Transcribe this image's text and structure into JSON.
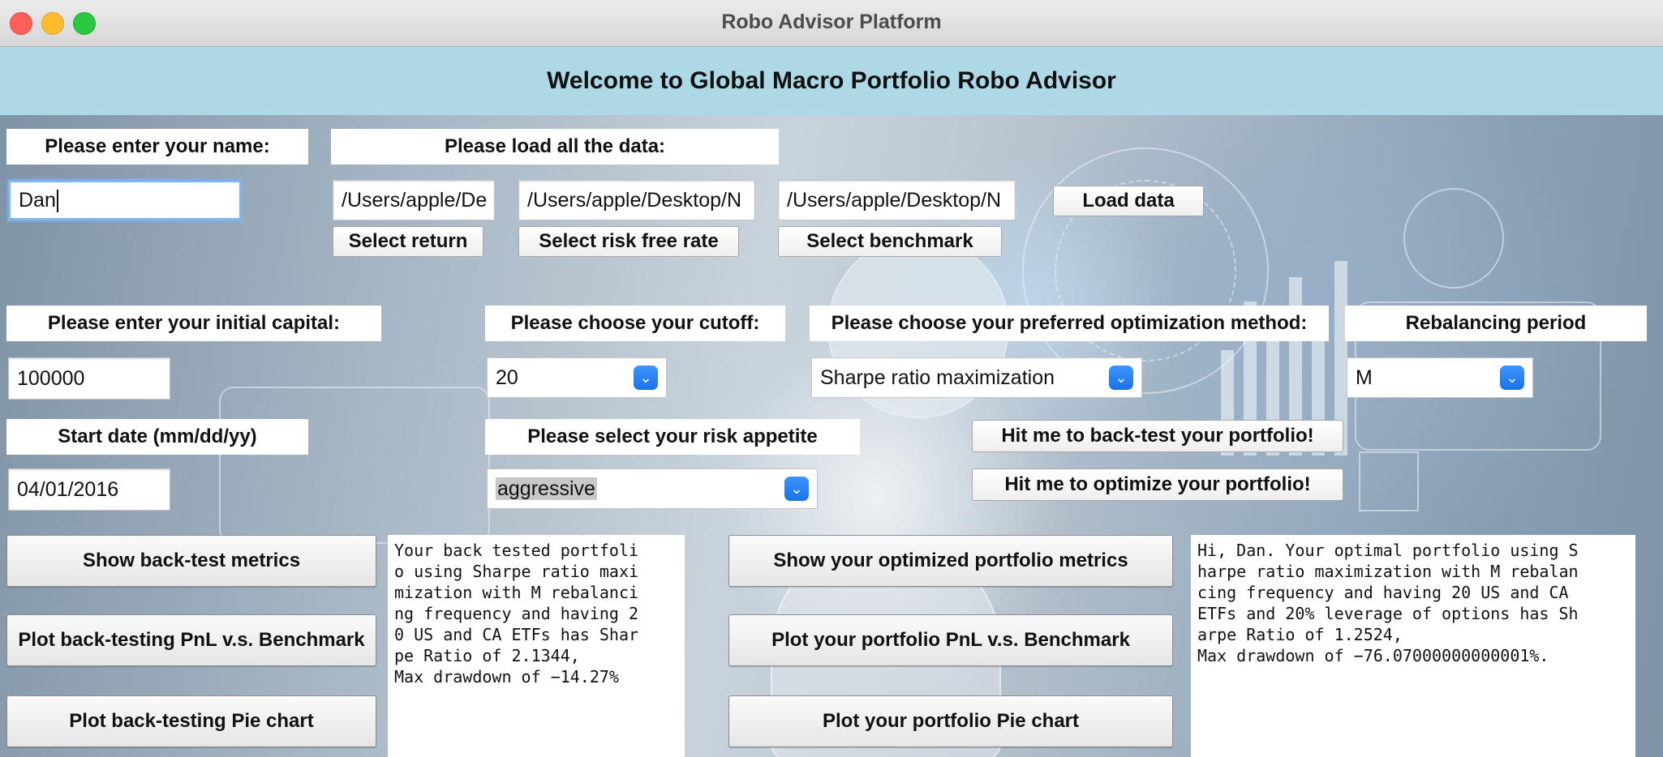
{
  "window": {
    "title": "Robo Advisor Platform"
  },
  "banner": {
    "text": "Welcome to Global Macro Portfolio Robo Advisor"
  },
  "name_section": {
    "label": "Please enter your name:",
    "value": "Dan"
  },
  "data_section": {
    "label": "Please load all the data:",
    "return_path": "/Users/apple/De",
    "risk_free_path": "/Users/apple/Desktop/N",
    "benchmark_path": "/Users/apple/Desktop/N",
    "select_return": "Select return",
    "select_risk_free": "Select risk free rate",
    "select_benchmark": "Select benchmark",
    "load_data": "Load data"
  },
  "capital_section": {
    "label": "Please enter your initial capital:",
    "value": "100000"
  },
  "cutoff_section": {
    "label": "Please choose your cutoff:",
    "selected": "20"
  },
  "method_section": {
    "label": "Please choose your preferred optimization method:",
    "selected": "Sharpe ratio maximization"
  },
  "rebalance_section": {
    "label": "Rebalancing period",
    "selected": "M"
  },
  "start_date_section": {
    "label": "Start date (mm/dd/yy)",
    "value": "04/01/2016"
  },
  "risk_section": {
    "label": "Please select your risk appetite",
    "selected": "aggressive"
  },
  "actions": {
    "backtest": "Hit me to back-test your portfolio!",
    "optimize": "Hit me to optimize your portfolio!"
  },
  "backtest_panel": {
    "metrics": "Show back-test metrics",
    "pnl": "Plot back-testing PnL v.s. Benchmark",
    "pie": "Plot back-testing Pie chart",
    "output": "Your back tested portfoli\no using Sharpe ratio maxi\nmization with M rebalanci\nng frequency and having 2\n0 US and CA ETFs has Shar\npe Ratio of 2.1344,\nMax drawdown of −14.27%"
  },
  "optimized_panel": {
    "metrics": "Show your optimized portfolio metrics",
    "pnl": "Plot your portfolio PnL v.s. Benchmark",
    "pie": "Plot your portfolio Pie chart",
    "output": "Hi, Dan. Your optimal portfolio using S\nharpe ratio maximization with M rebalan\ncing frequency and having 20 US and CA \nETFs and 20% leverage of options has Sh\narpe Ratio of 1.2524,\nMax drawdown of −76.07000000000001%."
  },
  "icons": {
    "dropdown": "chevron-down-icon"
  }
}
